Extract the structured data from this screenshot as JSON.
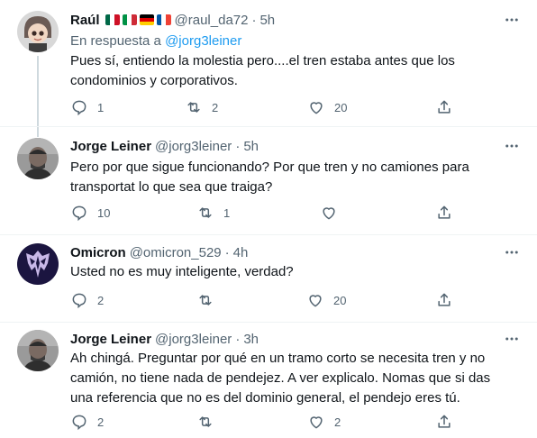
{
  "tweets": [
    {
      "name": "Raúl",
      "handle": "@raul_da72",
      "dot": "·",
      "time": "5h",
      "reply_prefix": "En respuesta a",
      "reply_handle": "@jorg3leiner",
      "text": "Pues sí, entiendo la molestia pero....el tren estaba antes que los condominios y corporativos.",
      "replies": "1",
      "retweets": "2",
      "likes": "20"
    },
    {
      "name": "Jorge Leiner",
      "handle": "@jorg3leiner",
      "dot": "·",
      "time": "5h",
      "text": "Pero por que sigue funcionando? Por que tren y no camiones para transportat lo que sea que traiga?",
      "replies": "10",
      "retweets": "1",
      "likes": ""
    },
    {
      "name": "Omicron",
      "handle": "@omicron_529",
      "dot": "·",
      "time": "4h",
      "text": "Usted no es muy inteligente, verdad?",
      "replies": "2",
      "retweets": "",
      "likes": "20"
    },
    {
      "name": "Jorge Leiner",
      "handle": "@jorg3leiner",
      "dot": "·",
      "time": "3h",
      "text": "Ah chingá. Preguntar por qué en un tramo corto se necesita tren y no camión, no tiene nada de pendejez.  A ver explicalo. Nomas que si das una referencia que no es del dominio general, el pendejo eres tú.",
      "replies": "2",
      "retweets": "",
      "likes": "2"
    }
  ],
  "flags": [
    "mexico",
    "italy",
    "germany",
    "france"
  ],
  "icons": [
    "more-icon",
    "reply-icon",
    "retweet-icon",
    "like-icon",
    "share-icon"
  ],
  "colors": {
    "text": "#0f1419",
    "secondary": "#536471",
    "link": "#1d9bf0",
    "divider": "#eff3f4"
  }
}
